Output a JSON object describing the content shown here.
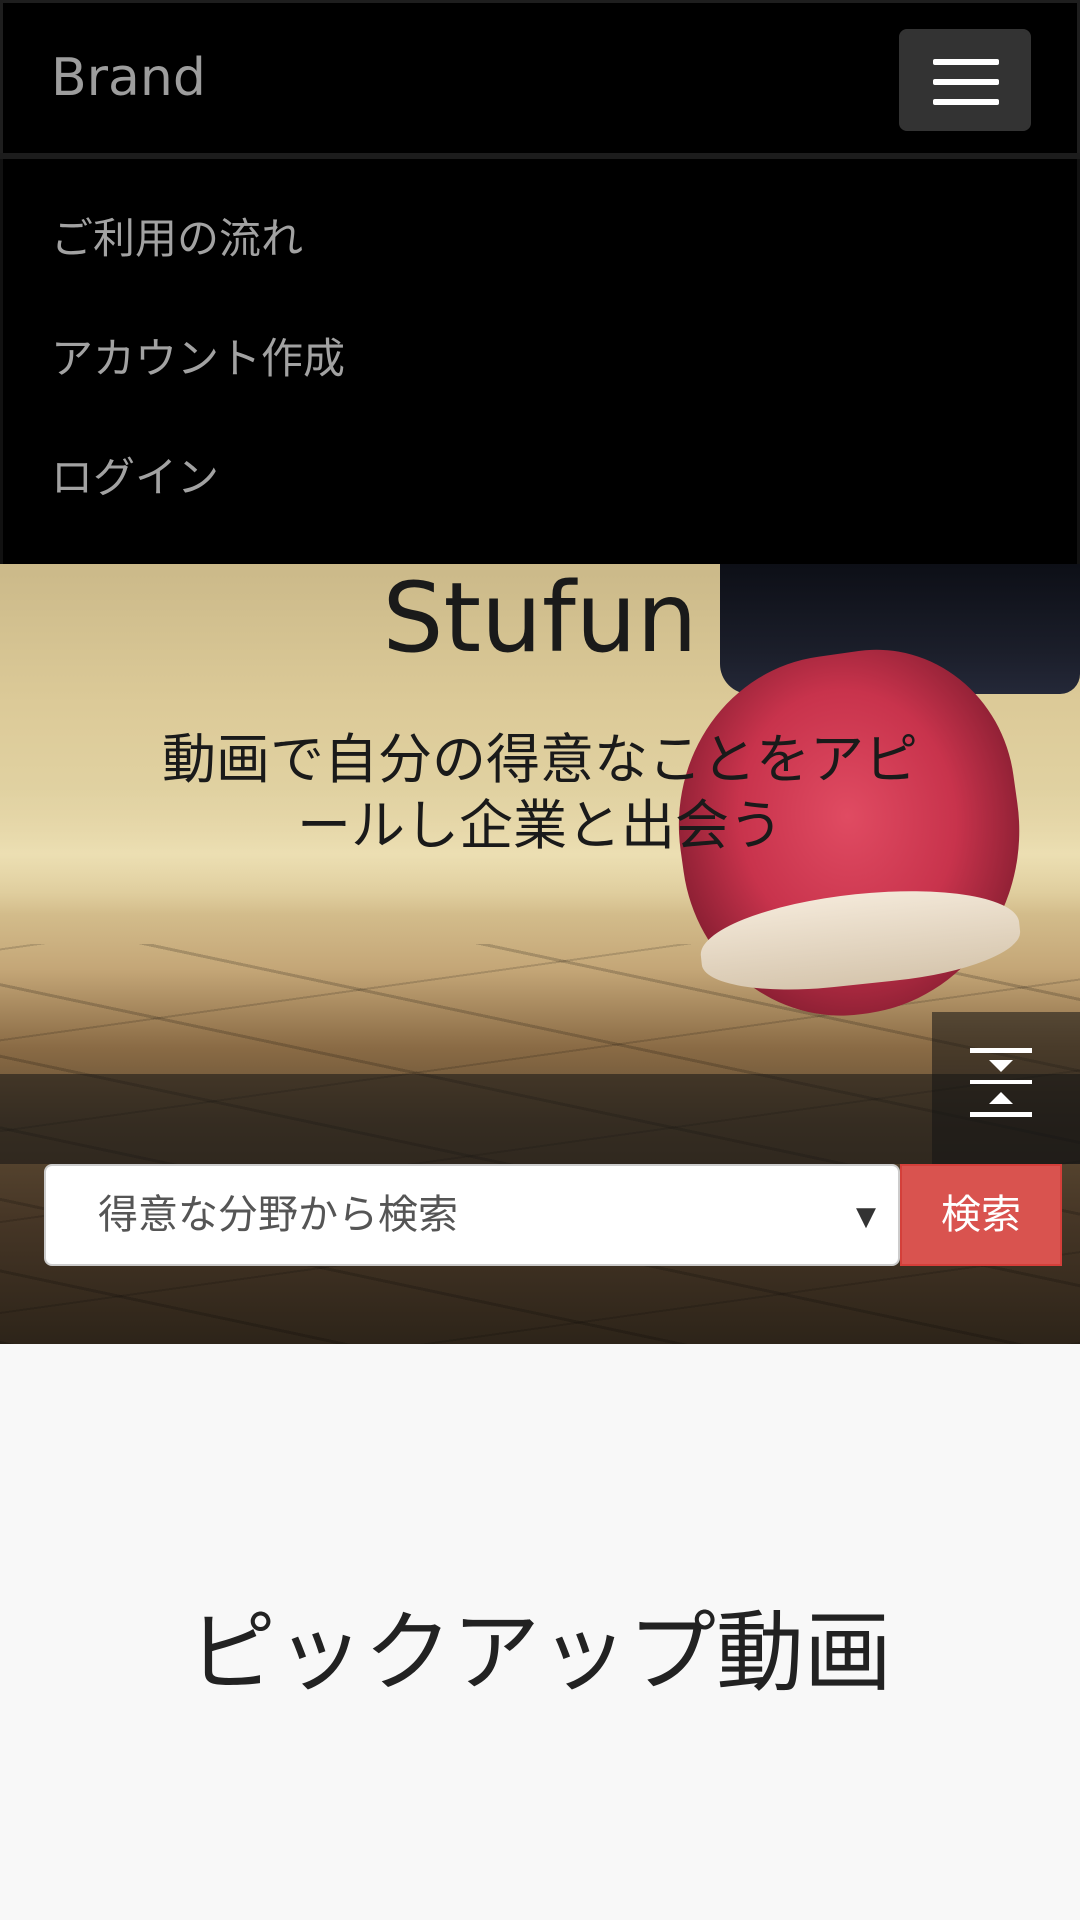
{
  "navbar": {
    "brand": "Brand",
    "menu_toggle_icon": "hamburger-menu-icon",
    "items": [
      {
        "label": "ご利用の流れ"
      },
      {
        "label": "アカウント作成"
      },
      {
        "label": "ログイン"
      }
    ]
  },
  "hero": {
    "title": "Stufun",
    "tagline": "動画で自分の得意なことをアピールし企業と出会う",
    "scroll_icon": "collapse-expand-icon",
    "search": {
      "select_value": "得意な分野から検索",
      "select_caret": "▼",
      "button_label": "検索"
    }
  },
  "pickup": {
    "title": "ピックアップ動画"
  },
  "colors": {
    "navbar_bg": "#000000",
    "nav_text": "#9d9d9d",
    "search_button": "#d9534f",
    "page_bg": "#f8f8f8"
  }
}
